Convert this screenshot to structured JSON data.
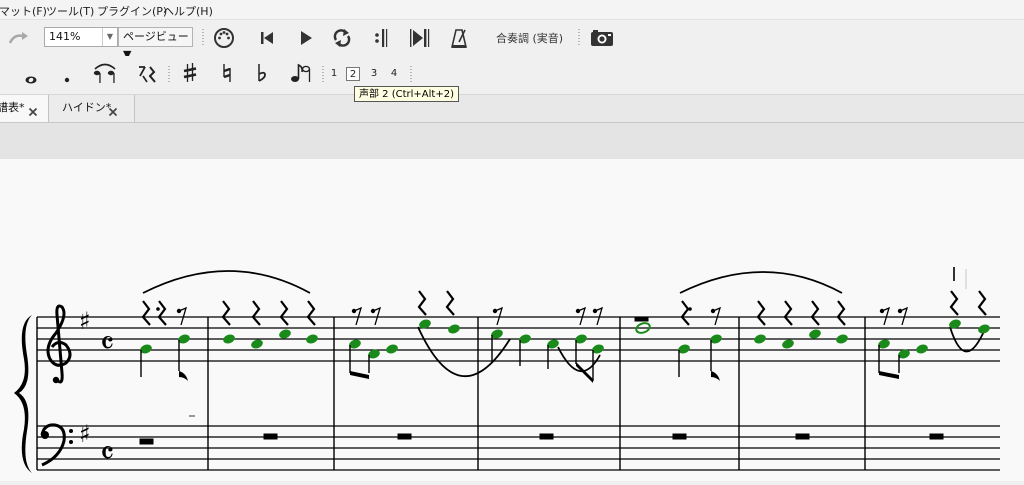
{
  "menu": {
    "items": [
      "マット(F)",
      "ツール(T)",
      "プラグイン(P)",
      "ヘルプ(H)"
    ]
  },
  "toolbar": {
    "zoom_value": "141%",
    "view_mode_value": "ページビュー",
    "concert_pitch_label": "合奏調 (実音)",
    "icons": [
      "redo-icon",
      "midi-icon",
      "rewind-icon",
      "play-icon",
      "loop-icon",
      "loop-in-icon",
      "loop-out-icon",
      "metronome-icon",
      "camera-icon"
    ]
  },
  "note_input": {
    "icons": [
      "whole-note-icon",
      "augmentation-dot-icon",
      "tie-icon",
      "rest-icon",
      "sharp-icon",
      "natural-icon",
      "flat-icon",
      "flip-direction-icon"
    ],
    "voices": [
      "1",
      "2",
      "3",
      "4"
    ],
    "active_voice": "2"
  },
  "tooltip": {
    "text": "声部 2 (Ctrl+Alt+2)"
  },
  "tabs": [
    {
      "label": "譜表*",
      "active": true
    },
    {
      "label": "ハイドン*",
      "active": false
    }
  ],
  "score": {
    "treble_key_sharp": "♯",
    "bass_key_sharp": "♯",
    "time_signature": "𝄴",
    "note_color": "#1a8a1a",
    "ink_color": "#000000"
  }
}
